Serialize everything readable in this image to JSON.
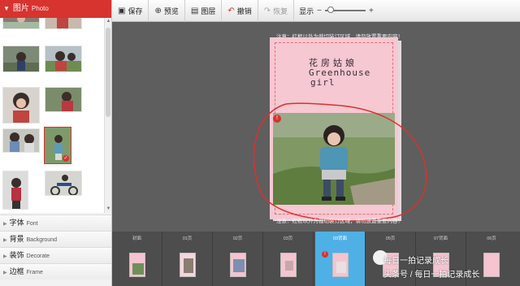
{
  "left_panel": {
    "header": {
      "label": "图片",
      "en": "Photo"
    },
    "categories": [
      {
        "label": "字体",
        "en": "Font"
      },
      {
        "label": "背景",
        "en": "Background"
      },
      {
        "label": "装饰",
        "en": "Decorate"
      },
      {
        "label": "边框",
        "en": "Frame"
      }
    ]
  },
  "toolbar": {
    "save": "保存",
    "preview": "预览",
    "layers": "图层",
    "undo": "撤销",
    "redo": "恢复",
    "display": "显示",
    "zoom_minus": "−",
    "zoom_plus": "+"
  },
  "canvas": {
    "note_top": "注意：红框以外为裁切装订区域，请勿放置重要内容！",
    "note_bottom": "注意：红框以外为裁切装订区域，请勿放置重要内容！",
    "cover_text_line1": "花房姑娘",
    "cover_text_line2": "Greenhouse",
    "cover_text_line3": "girl"
  },
  "pages": [
    {
      "label": "封面"
    },
    {
      "label": "01页"
    },
    {
      "label": "02页"
    },
    {
      "label": "03页"
    },
    {
      "label": "03背面"
    },
    {
      "label": "05页"
    },
    {
      "label": "07背面"
    },
    {
      "label": "06页"
    }
  ],
  "watermark": {
    "line1": "每日一拍记录成长",
    "line2": "头条号 / 每日一拍记录成长"
  },
  "colors": {
    "accent": "#d7332f",
    "selected_page": "#4fb0e6",
    "canvas_bg": "#5e5e5e"
  }
}
